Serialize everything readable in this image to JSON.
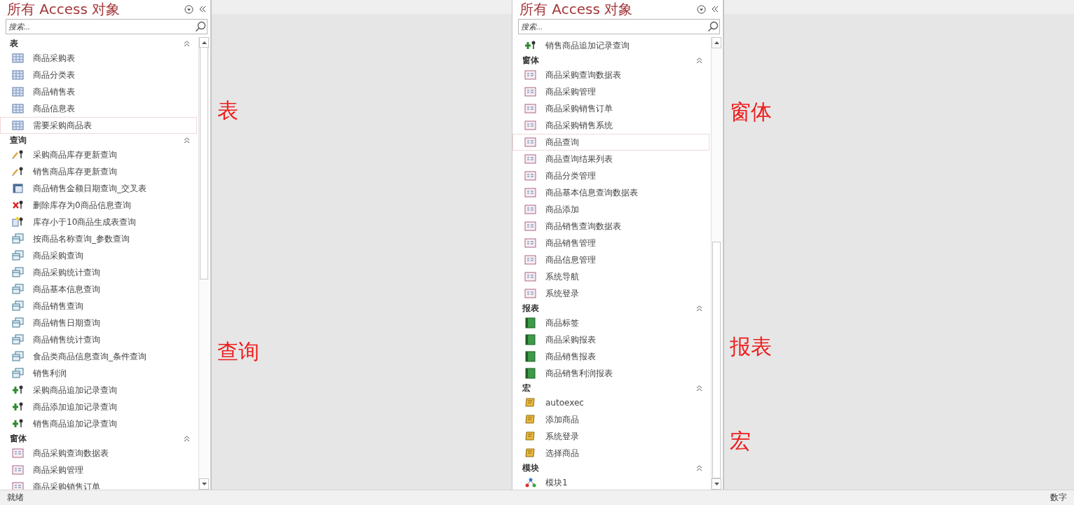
{
  "panes": [
    {
      "title": "所有 Access 对象",
      "search": {
        "placeholder": "搜索..."
      },
      "rows": [
        {
          "kind": "group",
          "label": "表",
          "expanded": true
        },
        {
          "kind": "table",
          "label": "商品采购表",
          "selected": false
        },
        {
          "kind": "table",
          "label": "商品分类表",
          "selected": false
        },
        {
          "kind": "table",
          "label": "商品销售表",
          "selected": false
        },
        {
          "kind": "table",
          "label": "商品信息表",
          "selected": false
        },
        {
          "kind": "table",
          "label": "需要采购商品表",
          "selected": true
        },
        {
          "kind": "group",
          "label": "查询",
          "expanded": true
        },
        {
          "kind": "update-query",
          "label": "采购商品库存更新查询",
          "selected": false
        },
        {
          "kind": "update-query",
          "label": "销售商品库存更新查询",
          "selected": false
        },
        {
          "kind": "crosstab-query",
          "label": "商品销售金额日期查询_交叉表",
          "selected": false
        },
        {
          "kind": "delete-query",
          "label": "删除库存为0商品信息查询",
          "selected": false
        },
        {
          "kind": "make-table-query",
          "label": "库存小于10商品生成表查询",
          "selected": false
        },
        {
          "kind": "select-query",
          "label": "按商品名称查询_参数查询",
          "selected": false
        },
        {
          "kind": "select-query",
          "label": "商品采购查询",
          "selected": false
        },
        {
          "kind": "select-query",
          "label": "商品采购统计查询",
          "selected": false
        },
        {
          "kind": "select-query",
          "label": "商品基本信息查询",
          "selected": false
        },
        {
          "kind": "select-query",
          "label": "商品销售查询",
          "selected": false
        },
        {
          "kind": "select-query",
          "label": "商品销售日期查询",
          "selected": false
        },
        {
          "kind": "select-query",
          "label": "商品销售统计查询",
          "selected": false
        },
        {
          "kind": "select-query",
          "label": "食品类商品信息查询_条件查询",
          "selected": false
        },
        {
          "kind": "select-query",
          "label": "销售利润",
          "selected": false
        },
        {
          "kind": "append-query",
          "label": "采购商品追加记录查询",
          "selected": false
        },
        {
          "kind": "append-query",
          "label": "商品添加追加记录查询",
          "selected": false
        },
        {
          "kind": "append-query",
          "label": "销售商品追加记录查询",
          "selected": false
        },
        {
          "kind": "group",
          "label": "窗体",
          "expanded": true
        },
        {
          "kind": "form",
          "label": "商品采购查询数据表",
          "selected": false
        },
        {
          "kind": "form",
          "label": "商品采购管理",
          "selected": false
        },
        {
          "kind": "form",
          "label": "商品采购销售订单",
          "selected": false
        }
      ]
    },
    {
      "title": "所有 Access 对象",
      "search": {
        "placeholder": "搜索..."
      },
      "rows": [
        {
          "kind": "append-query",
          "label": "销售商品追加记录查询",
          "selected": false
        },
        {
          "kind": "group",
          "label": "窗体",
          "expanded": true
        },
        {
          "kind": "form",
          "label": "商品采购查询数据表",
          "selected": false
        },
        {
          "kind": "form",
          "label": "商品采购管理",
          "selected": false
        },
        {
          "kind": "form",
          "label": "商品采购销售订单",
          "selected": false
        },
        {
          "kind": "form",
          "label": "商品采购销售系统",
          "selected": false
        },
        {
          "kind": "form",
          "label": "商品查询",
          "selected": true
        },
        {
          "kind": "form",
          "label": "商品查询结果列表",
          "selected": false
        },
        {
          "kind": "form",
          "label": "商品分类管理",
          "selected": false
        },
        {
          "kind": "form",
          "label": "商品基本信息查询数据表",
          "selected": false
        },
        {
          "kind": "form",
          "label": "商品添加",
          "selected": false
        },
        {
          "kind": "form",
          "label": "商品销售查询数据表",
          "selected": false
        },
        {
          "kind": "form",
          "label": "商品销售管理",
          "selected": false
        },
        {
          "kind": "form",
          "label": "商品信息管理",
          "selected": false
        },
        {
          "kind": "form",
          "label": "系统导航",
          "selected": false
        },
        {
          "kind": "form",
          "label": "系统登录",
          "selected": false
        },
        {
          "kind": "group",
          "label": "报表",
          "expanded": true
        },
        {
          "kind": "report",
          "label": "商品标签",
          "selected": false
        },
        {
          "kind": "report",
          "label": "商品采购报表",
          "selected": false
        },
        {
          "kind": "report",
          "label": "商品销售报表",
          "selected": false
        },
        {
          "kind": "report",
          "label": "商品销售利润报表",
          "selected": false
        },
        {
          "kind": "group",
          "label": "宏",
          "expanded": true
        },
        {
          "kind": "macro",
          "label": "autoexec",
          "selected": false
        },
        {
          "kind": "macro",
          "label": "添加商品",
          "selected": false
        },
        {
          "kind": "macro",
          "label": "系统登录",
          "selected": false
        },
        {
          "kind": "macro",
          "label": "选择商品",
          "selected": false
        },
        {
          "kind": "group",
          "label": "模块",
          "expanded": true
        },
        {
          "kind": "module",
          "label": "模块1",
          "selected": false
        }
      ]
    }
  ],
  "annotations": [
    [
      {
        "text": "表"
      },
      {
        "text": "查询"
      }
    ],
    [
      {
        "text": "窗体"
      },
      {
        "text": "报表"
      },
      {
        "text": "宏"
      }
    ]
  ],
  "status_bar": {
    "left": "就绪",
    "right": "数字"
  }
}
